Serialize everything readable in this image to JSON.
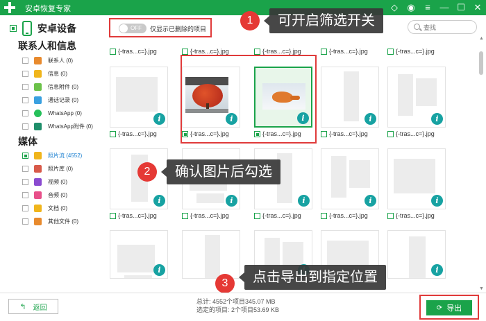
{
  "window": {
    "title": "安卓恢复专家"
  },
  "device": {
    "label": "安卓设备"
  },
  "sections": {
    "contacts_title": "联系人和信息",
    "media_title": "媒体"
  },
  "contact_items": [
    {
      "label": "联系人 (0)",
      "icon": "contacts-icon",
      "color": "#e88a2e"
    },
    {
      "label": "信息 (0)",
      "icon": "message-icon",
      "color": "#f0b51c"
    },
    {
      "label": "信息附件 (0)",
      "icon": "attachment-icon",
      "color": "#6cc24a"
    },
    {
      "label": "通话记录 (0)",
      "icon": "call-log-icon",
      "color": "#3aa0e0"
    },
    {
      "label": "WhatsApp (0)",
      "icon": "whatsapp-icon",
      "color": "#25c05a"
    },
    {
      "label": "WhatsApp附件 (0)",
      "icon": "whatsapp-attachment-icon",
      "color": "#1f8e6a"
    }
  ],
  "media_items": [
    {
      "label": "照片流 (4552)",
      "icon": "photo-stream-icon",
      "color": "#f0b51c",
      "active": true
    },
    {
      "label": "照片库 (0)",
      "icon": "photo-library-icon",
      "color": "#d85a4a"
    },
    {
      "label": "视频 (0)",
      "icon": "video-icon",
      "color": "#8a4bd0"
    },
    {
      "label": "音频 (0)",
      "icon": "audio-icon",
      "color": "#e8508a"
    },
    {
      "label": "文档 (0)",
      "icon": "document-icon",
      "color": "#f0b51c"
    },
    {
      "label": "其他文件 (0)",
      "icon": "other-files-icon",
      "color": "#e88a2e"
    }
  ],
  "toolbar": {
    "toggle_state": "OFF",
    "toggle_label": "仅显示已删除的项目",
    "search_placeholder": "查找"
  },
  "file_name": "{-tras...c=}.jpg",
  "callouts": [
    {
      "number": "1",
      "text": "可开启筛选开关"
    },
    {
      "number": "2",
      "text": "确认图片后勾选"
    },
    {
      "number": "3",
      "text": "点击导出到指定位置"
    }
  ],
  "footer": {
    "back_label": "返回",
    "total_line": "总计: 4552个项目345.07 MB",
    "selected_line": "选定的项目: 2个项目53.69 KB",
    "export_label": "导出"
  }
}
